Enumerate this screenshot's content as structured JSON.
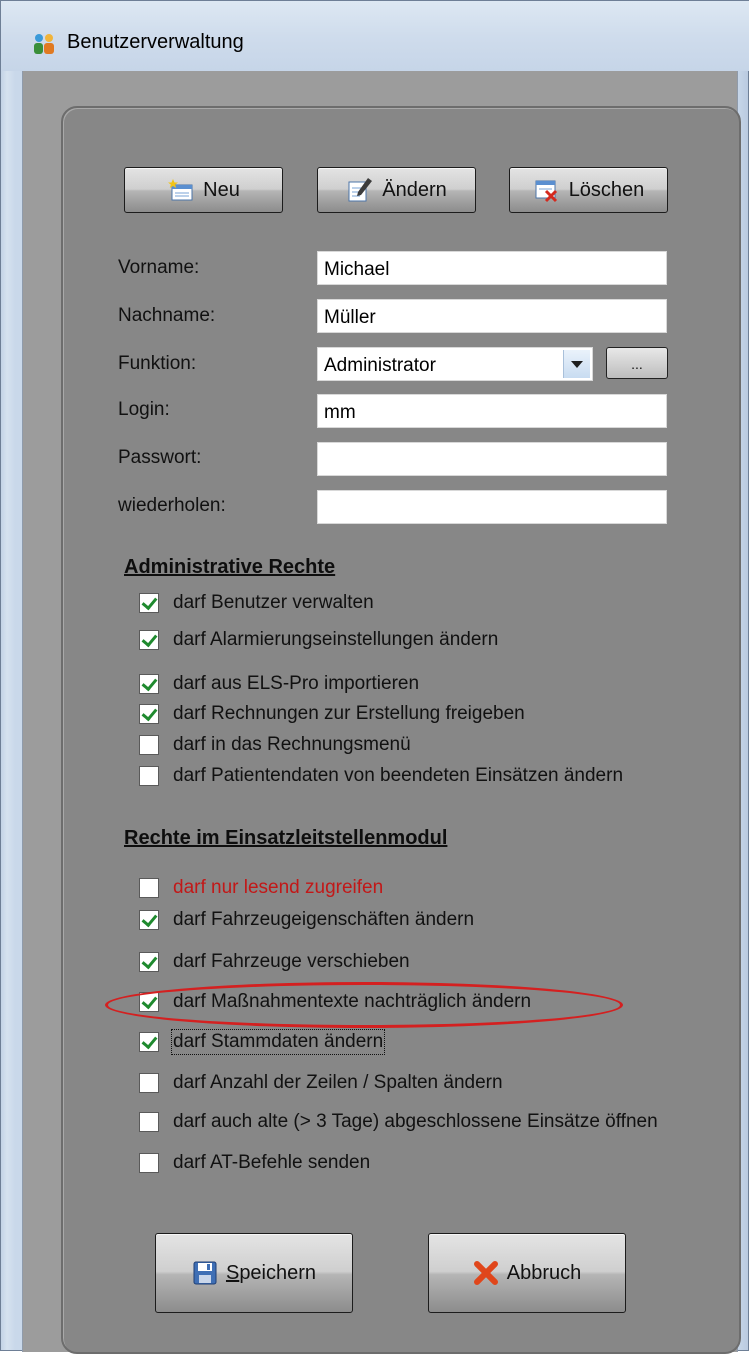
{
  "window": {
    "title": "Benutzerverwaltung",
    "icon": "people-icon"
  },
  "toolbar": {
    "new_label": "Neu",
    "edit_label": "Ändern",
    "delete_label": "Löschen"
  },
  "form": {
    "first_name_label": "Vorname:",
    "first_name_value": "Michael",
    "last_name_label": "Nachname:",
    "last_name_value": "Müller",
    "function_label": "Funktion:",
    "function_value": "Administrator",
    "function_more_label": "...",
    "login_label": "Login:",
    "login_value": "mm",
    "password_label": "Passwort:",
    "password_value": "",
    "repeat_label": "wiederholen:",
    "repeat_value": ""
  },
  "admin_rights": {
    "title": "Administrative Rechte",
    "items": [
      {
        "label": "darf Benutzer verwalten",
        "checked": true
      },
      {
        "label": "darf Alarmierungseinstellungen ändern",
        "checked": true
      },
      {
        "label": "darf aus ELS-Pro importieren",
        "checked": true
      },
      {
        "label": "darf Rechnungen zur Erstellung freigeben",
        "checked": true
      },
      {
        "label": "darf in das Rechnungsmenü",
        "checked": false
      },
      {
        "label": "darf Patientendaten von beendeten Einsätzen ändern",
        "checked": false
      }
    ]
  },
  "dispatch_rights": {
    "title": "Rechte im Einsatzleitstellenmodul",
    "items": [
      {
        "label": "darf nur lesend zugreifen",
        "checked": false,
        "color": "#c21818"
      },
      {
        "label": "darf Fahrzeugeigenschäften ändern",
        "checked": true
      },
      {
        "label": "darf Fahrzeuge verschieben",
        "checked": true
      },
      {
        "label": "darf Maßnahmentexte nachträglich ändern",
        "checked": true,
        "highlight_color": "#d42020"
      },
      {
        "label": "darf Stammdaten ändern",
        "checked": true
      },
      {
        "label": "darf Anzahl der Zeilen / Spalten ändern",
        "checked": false
      },
      {
        "label": "darf auch alte (> 3 Tage) abgeschlossene Einsätze öffnen",
        "checked": false
      },
      {
        "label": "darf AT-Befehle senden",
        "checked": false
      }
    ]
  },
  "footer": {
    "save_label": "Speichern",
    "cancel_label": "Abbruch"
  }
}
